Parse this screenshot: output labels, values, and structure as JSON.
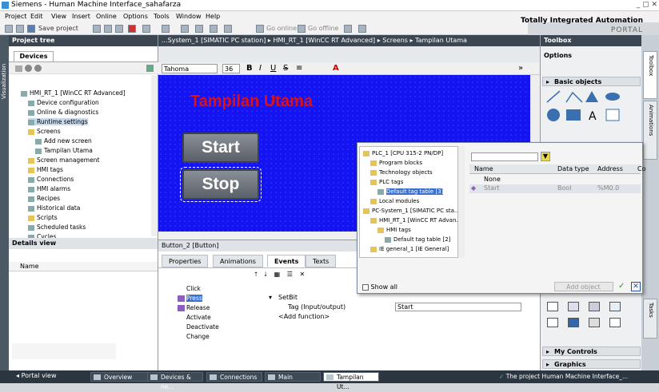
{
  "window": {
    "title": "Siemens  -  Human Machine Interface_sahafarza",
    "controls": "_ ▢ ✕"
  },
  "menu": [
    "Project",
    "Edit",
    "View",
    "Insert",
    "Online",
    "Options",
    "Tools",
    "Window",
    "Help"
  ],
  "brand": {
    "line1": "Totally Integrated Automation",
    "line2": "PORTAL"
  },
  "toolbar": {
    "save": "Save project",
    "go_online": "Go online",
    "go_offline": "Go offline"
  },
  "breadcrumb": "...System_1 [SIMATIC PC station]  ▸  HMI_RT_1 [WinCC RT Advanced]  ▸  Screens  ▸  Tampilan Utama",
  "project_tree": {
    "title": "Project tree",
    "tab": "Devices",
    "items": [
      {
        "label": "HMI_RT_1 [WinCC RT Advanced]",
        "indent": 1,
        "folder": false
      },
      {
        "label": "Device configuration",
        "indent": 2,
        "folder": false
      },
      {
        "label": "Online & diagnostics",
        "indent": 2,
        "folder": false
      },
      {
        "label": "Runtime settings",
        "indent": 2,
        "folder": false
      },
      {
        "label": "Screens",
        "indent": 2,
        "folder": true
      },
      {
        "label": "Add new screen",
        "indent": 3,
        "folder": false
      },
      {
        "label": "Tampilan Utama",
        "indent": 3,
        "folder": false
      },
      {
        "label": "Screen management",
        "indent": 2,
        "folder": true
      },
      {
        "label": "HMI tags",
        "indent": 2,
        "folder": true
      },
      {
        "label": "Connections",
        "indent": 2,
        "folder": false
      },
      {
        "label": "HMI alarms",
        "indent": 2,
        "folder": false
      },
      {
        "label": "Recipes",
        "indent": 2,
        "folder": false
      },
      {
        "label": "Historical data",
        "indent": 2,
        "folder": false
      },
      {
        "label": "Scripts",
        "indent": 2,
        "folder": true
      },
      {
        "label": "Scheduled tasks",
        "indent": 2,
        "folder": false
      },
      {
        "label": "Cycles",
        "indent": 2,
        "folder": false
      }
    ]
  },
  "side_tab": "Visualization",
  "details": {
    "title": "Details view",
    "col": "Name"
  },
  "format": {
    "font": "Tahoma",
    "size": "36"
  },
  "screen": {
    "title": "Tampilan Utama",
    "btn_start": "Start",
    "btn_stop": "Stop"
  },
  "props": {
    "title": "Button_2 [Button]",
    "tabs": [
      "Properties",
      "Animations",
      "Events",
      "Texts"
    ],
    "events": [
      "Click",
      "Press",
      "Release",
      "Activate",
      "Deactivate",
      "Change"
    ],
    "func": "SetBit",
    "param": "Tag (Input/output)",
    "value": "Start",
    "add": "<Add function>"
  },
  "toolbox": {
    "title": "Toolbox",
    "options": "Options",
    "basic": "Basic objects",
    "controls": "My Controls",
    "graphics": "Graphics"
  },
  "right_tabs": [
    "Toolbox",
    "Animations",
    "Tasks"
  ],
  "popup": {
    "tree": [
      {
        "label": "PLC_1 [CPU 315-2 PN/DP]",
        "indent": 0
      },
      {
        "label": "Program blocks",
        "indent": 1
      },
      {
        "label": "Technology objects",
        "indent": 1
      },
      {
        "label": "PLC tags",
        "indent": 1
      },
      {
        "label": "Default tag table [3]",
        "indent": 2
      },
      {
        "label": "Local modules",
        "indent": 1
      },
      {
        "label": "PC-System_1 [SIMATIC PC sta...",
        "indent": 0
      },
      {
        "label": "HMI_RT_1 [WinCC RT Advan...",
        "indent": 1
      },
      {
        "label": "HMI tags",
        "indent": 2
      },
      {
        "label": "Default tag table [2]",
        "indent": 3
      },
      {
        "label": "IE general_1 [IE General]",
        "indent": 1
      }
    ],
    "cols": [
      "Name",
      "Data type",
      "Address",
      "Co"
    ],
    "rows": [
      {
        "name": "None",
        "type": "",
        "addr": ""
      },
      {
        "name": "Start",
        "type": "Bool",
        "addr": "%M0.0"
      }
    ],
    "show_all": "Show all",
    "add_object": "Add object"
  },
  "status": {
    "portal": "Portal view",
    "tabs": [
      "Overview",
      "Devices & ne...",
      "Connections",
      "Main",
      "Tampilan Ut..."
    ],
    "message": "The project Human Machine Interface_..."
  }
}
